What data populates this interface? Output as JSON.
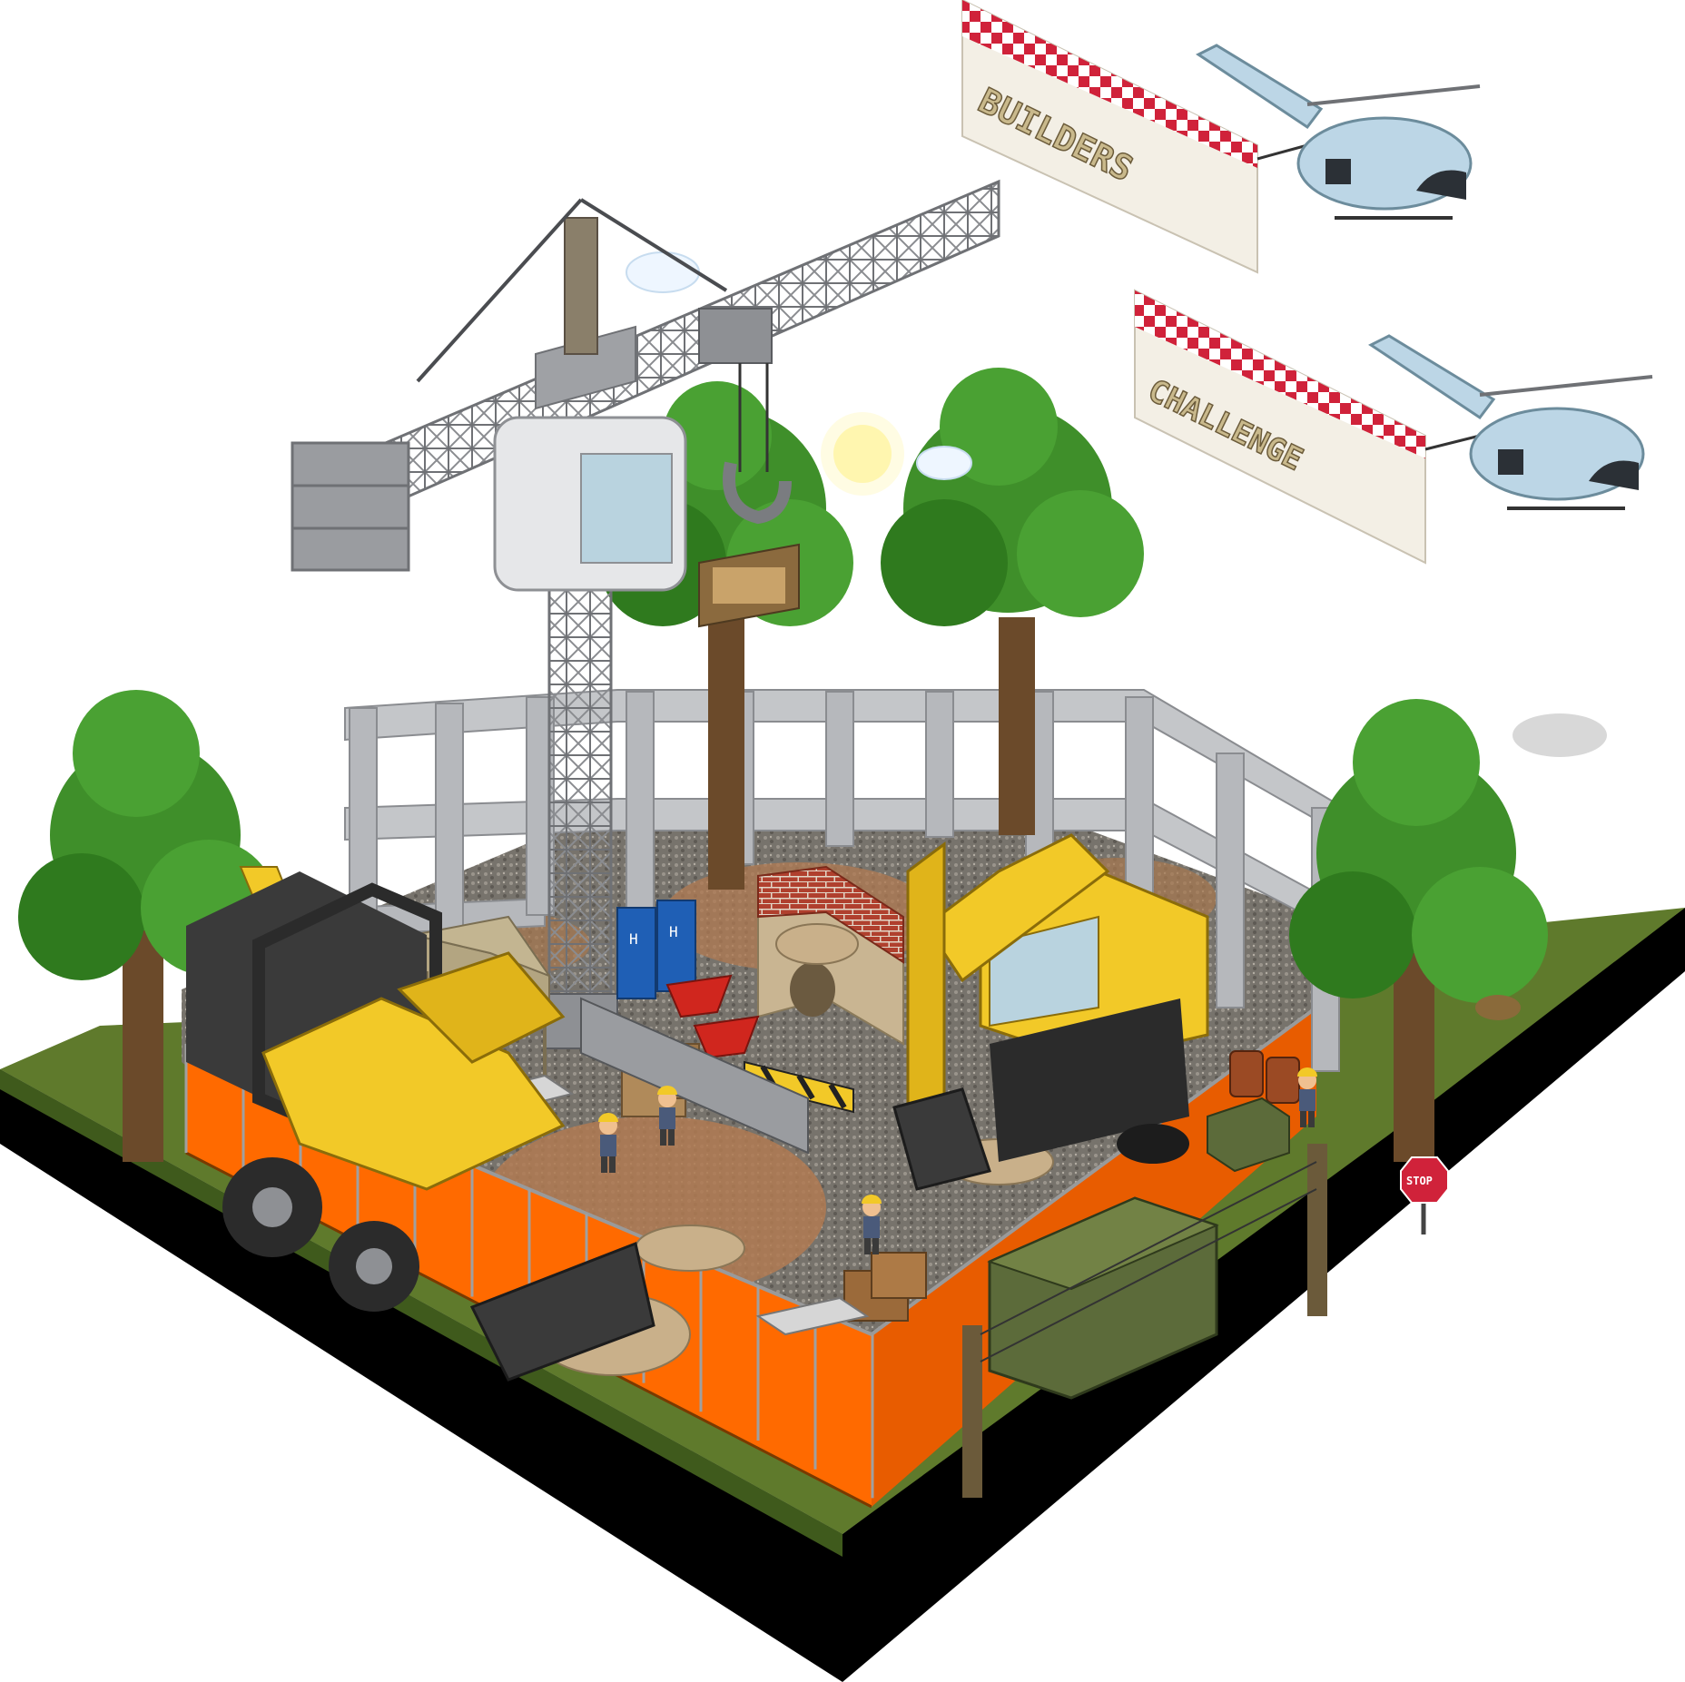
{
  "banners": [
    {
      "text": "BUILDERS"
    },
    {
      "text": "CHALLENGE"
    }
  ],
  "signs": {
    "stop": "STOP",
    "toilet_letter": "H"
  },
  "colors": {
    "grass": "#5f7a2c",
    "grass_dark": "#3f5a1c",
    "base": "#000000",
    "gravel": "#7c7770",
    "dirt": "#b07a52",
    "fence": "#ff6a00",
    "fence_dark": "#c94c00",
    "concrete": "#c4c6c9",
    "concrete_dark": "#9a9ca0",
    "machine_yellow": "#f2c928",
    "machine_yellow_dark": "#c79a12",
    "tree_green": "#3f8f2a",
    "tree_trunk": "#6b4a2a",
    "banner_red": "#d0223a",
    "helicopter": "#bcd6e6"
  },
  "icons": [
    "tower-crane",
    "helicopter",
    "wheel-loader",
    "excavator",
    "portable-toilet",
    "brick-wall",
    "wheelbarrow",
    "tree",
    "construction-worker",
    "stop-sign",
    "shipping-container",
    "sun",
    "oil-barrel",
    "sandbag-pile"
  ]
}
